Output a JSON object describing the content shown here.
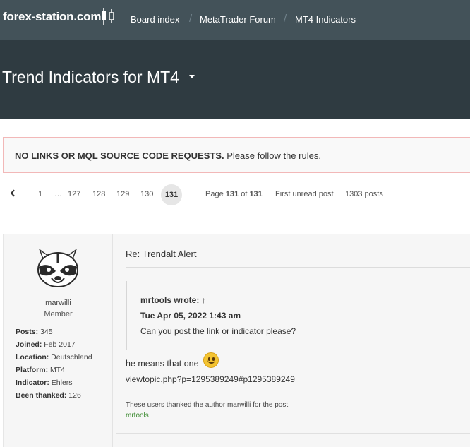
{
  "header": {
    "logo_text": "forex-station.com",
    "breadcrumbs": [
      "Board index",
      "MetaTrader Forum",
      "MT4 Indicators"
    ]
  },
  "forum": {
    "title": "Trend Indicators for MT4"
  },
  "notice": {
    "strong": "NO LINKS OR MQL SOURCE CODE REQUESTS.",
    "text": "Please follow the",
    "link": "rules",
    "end": "."
  },
  "pagination": {
    "pages": [
      "1",
      "…",
      "127",
      "128",
      "129",
      "130"
    ],
    "current": "131",
    "page_label": "Page",
    "page_num": "131",
    "of_label": "of",
    "total_pages": "131",
    "first_unread": "First unread post",
    "post_count": "1303 posts"
  },
  "post": {
    "author": {
      "username": "marwilli",
      "rank": "Member",
      "details": [
        {
          "label": "Posts:",
          "value": "345"
        },
        {
          "label": "Joined:",
          "value": "Feb 2017"
        },
        {
          "label": "Location:",
          "value": "Deutschland"
        },
        {
          "label": "Platform:",
          "value": "MT4"
        },
        {
          "label": "Indicator:",
          "value": "Ehlers"
        },
        {
          "label": "Been thanked:",
          "value": "126"
        }
      ]
    },
    "title": "Re: Trendalt Alert",
    "quote": {
      "author": "mrtools wrote: ↑",
      "date": "Tue Apr 05, 2022 1:43 am",
      "body": "Can you post the link or indicator please?"
    },
    "reply": "he means that one",
    "link": "viewtopic.php?p=1295389249#p1295389249",
    "thanks_text": "These users thanked the author marwilli for the post:",
    "thanks_users": "mrtools"
  },
  "colors": {
    "topbar": "#435259",
    "hero": "#2f3b41",
    "notice_border": "#f2b8b8",
    "thanks_user": "#3b8a2f"
  }
}
